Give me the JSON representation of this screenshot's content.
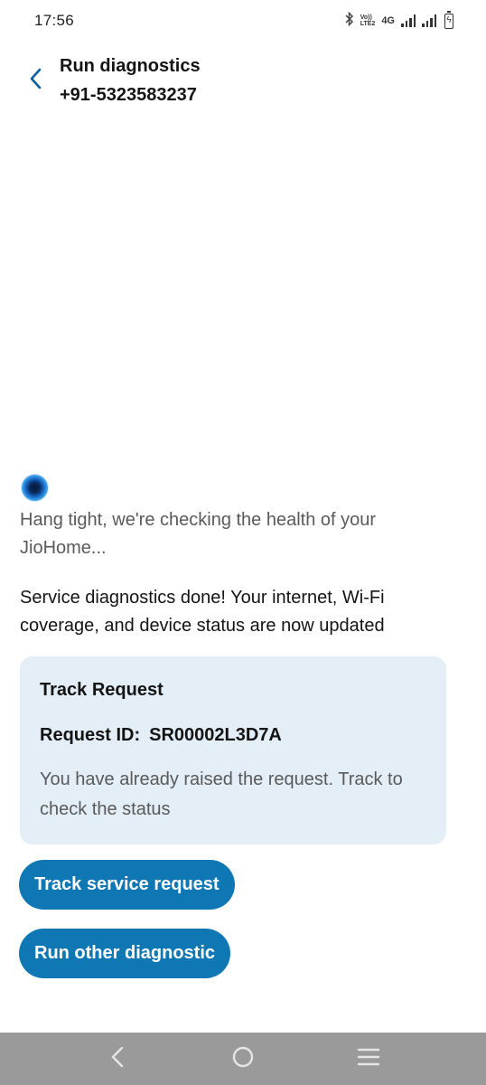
{
  "status_bar": {
    "time": "17:56",
    "volte_top": "Vo))",
    "volte_bottom": "LTE2",
    "network": "4G"
  },
  "header": {
    "title": "Run diagnostics",
    "subtitle": "+91-5323583237"
  },
  "messages": {
    "loading": "Hang tight, we're checking the health of your JioHome...",
    "done": "Service diagnostics done! Your internet, Wi-Fi coverage, and device status are now updated"
  },
  "track_card": {
    "title": "Track Request",
    "request_label": "Request ID:",
    "request_id": "SR00002L3D7A",
    "description": "You have already raised the request. Track to check the status"
  },
  "buttons": {
    "track_service_request": "Track service request",
    "run_other_diagnostic": "Run other diagnostic"
  },
  "colors": {
    "accent": "#0f78b4",
    "card_bg": "#e3eef7",
    "nav_bar": "#9a9a9a",
    "back_arrow": "#0f5e9c"
  },
  "icons": {
    "back": "chevron-left-icon",
    "bot": "jio-assistant-avatar-icon",
    "nav_back": "nav-back-icon",
    "nav_home": "nav-home-icon",
    "nav_menu": "nav-menu-icon"
  }
}
